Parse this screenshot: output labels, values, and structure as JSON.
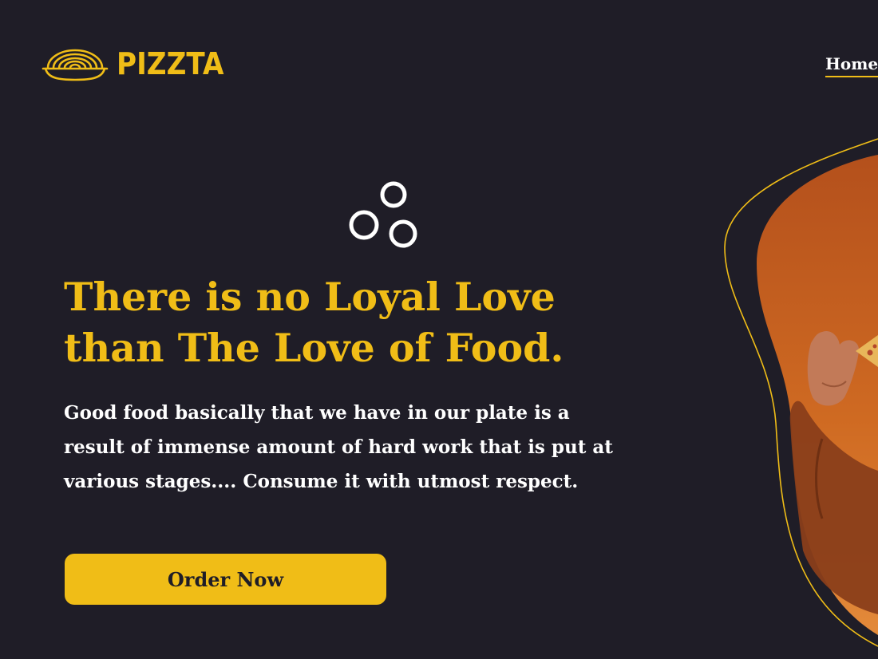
{
  "header": {
    "brand_name": "PIZZTA",
    "logo_icon": "noodle-bowl-icon",
    "nav": {
      "home_label": "Home"
    }
  },
  "hero": {
    "decor_icon": "three-rings-icon",
    "headline": "There is no Loyal Love than The Love of Food.",
    "description": "Good food basically that we have in our plate is a result of immense amount of hard work that is put at various stages.... Consume it with utmost respect.",
    "cta_label": "Order Now",
    "image_subject": "person-eating-pizza-image"
  },
  "colors": {
    "background": "#1f1d27",
    "accent": "#f0bd17",
    "text": "#ffffff",
    "image_orange": "#c9601a"
  }
}
